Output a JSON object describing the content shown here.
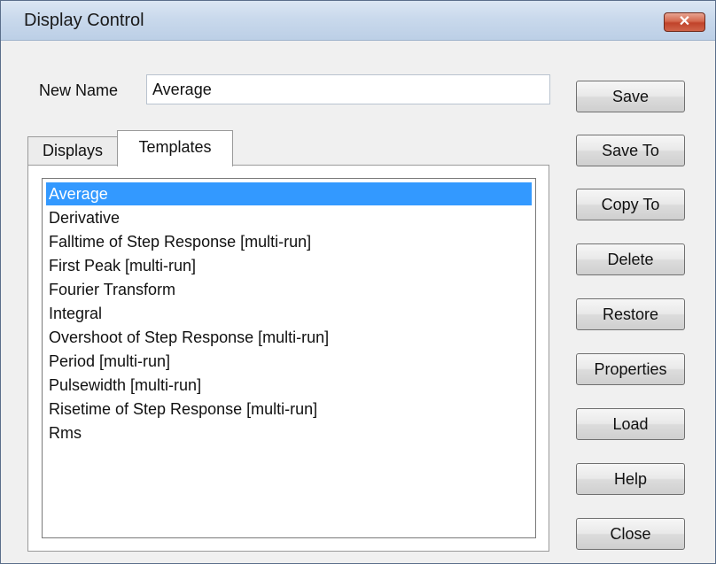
{
  "window": {
    "title": "Display Control",
    "close_symbol": "✕"
  },
  "name_field": {
    "label": "New Name",
    "value": "Average"
  },
  "tabs": [
    {
      "label": "Displays",
      "active": false
    },
    {
      "label": "Templates",
      "active": true
    }
  ],
  "templates_list": {
    "items": [
      "Average",
      "Derivative",
      "Falltime of Step Response [multi-run]",
      "First Peak [multi-run]",
      "Fourier Transform",
      "Integral",
      "Overshoot of Step Response [multi-run]",
      "Period [multi-run]",
      "Pulsewidth [multi-run]",
      "Risetime of Step Response [multi-run]",
      "Rms"
    ],
    "selected_index": 0
  },
  "buttons": {
    "save": "Save",
    "save_to": "Save To",
    "copy_to": "Copy To",
    "delete": "Delete",
    "restore": "Restore",
    "properties": "Properties",
    "load": "Load",
    "help": "Help",
    "close": "Close"
  },
  "colors": {
    "selection": "#3399ff",
    "dialog_background": "#f0f0f0",
    "close_button": "#c0432a"
  }
}
